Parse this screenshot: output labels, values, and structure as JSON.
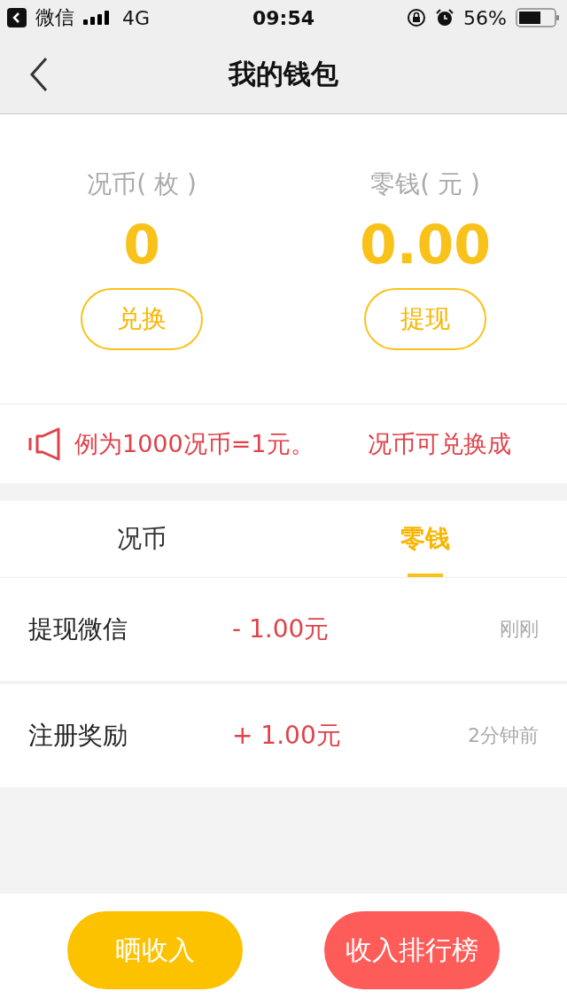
{
  "status_bar": {
    "back_app": "微信",
    "network": "4G",
    "time": "09:54",
    "battery": "56%"
  },
  "nav": {
    "title": "我的钱包"
  },
  "balances": [
    {
      "label": "况币( 枚 )",
      "value": "0",
      "action": "兑换"
    },
    {
      "label": "零钱( 元 )",
      "value": "0.00",
      "action": "提现"
    }
  ],
  "notice": {
    "texts": [
      "例为1000况币=1元。",
      "况币可兑换成"
    ]
  },
  "tabs": [
    {
      "label": "况币",
      "selected": false
    },
    {
      "label": "零钱",
      "selected": true
    }
  ],
  "records": [
    {
      "title": "提现微信",
      "amount": "- 1.00元",
      "time": "刚刚"
    },
    {
      "title": "注册奖励",
      "amount": "+ 1.00元",
      "time": "2分钟前"
    }
  ],
  "bottom_buttons": [
    {
      "label": "晒收入",
      "kind": "primary"
    },
    {
      "label": "收入排行榜",
      "kind": "danger"
    }
  ]
}
